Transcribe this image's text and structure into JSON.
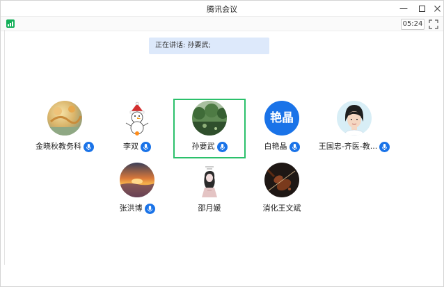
{
  "window": {
    "title": "腾讯会议"
  },
  "toolbar": {
    "timer": "05:24"
  },
  "speaking": {
    "text": "正在讲话: 孙要武;"
  },
  "participants": [
    {
      "name": "金晓秋教务科",
      "avatar": "landscape-avatar",
      "mic": true
    },
    {
      "name": "李双",
      "avatar": "snowman-avatar",
      "mic": true
    },
    {
      "name": "孙要武",
      "avatar": "green-park-avatar",
      "mic": true,
      "active": true
    },
    {
      "name": "白艳晶",
      "avatar": "text-avatar",
      "avatar_text": "艳晶",
      "mic": true
    },
    {
      "name": "王国忠-齐医-教...",
      "avatar": "illustrated-portrait-avatar",
      "mic": true
    },
    {
      "name": "张洪博",
      "avatar": "sunset-avatar",
      "mic": true
    },
    {
      "name": "邵月媛",
      "avatar": "girl-sketch-avatar",
      "mic": false
    },
    {
      "name": "消化王文斌",
      "avatar": "violin-avatar",
      "mic": false
    }
  ],
  "colors": {
    "accent_blue": "#1a73e8",
    "speaking_bg": "#dde9fb",
    "active_border": "#2bc06b",
    "signal_green": "#15b05a"
  }
}
